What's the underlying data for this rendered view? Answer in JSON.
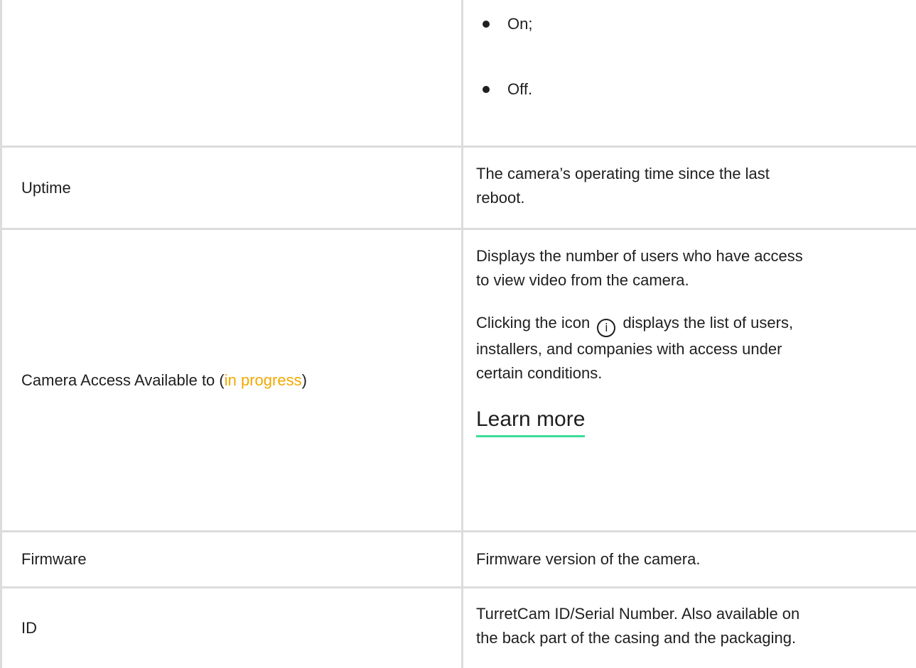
{
  "rows": [
    {
      "label": "",
      "bullets": [
        "On;",
        "Off."
      ]
    },
    {
      "label": "Uptime",
      "text_lines": [
        "The camera’s operating time since the last",
        "reboot."
      ]
    },
    {
      "label_main": "Camera Access Available to (",
      "label_link": "in progress",
      "label_end": ")",
      "para1_lines": [
        "Displays the number of users who have access",
        "to view video from the camera."
      ],
      "para2_before_icon": "Clicking the icon",
      "icon_glyph": "i",
      "para2_after_icon": "displays the list of users,",
      "para2_lines": [
        "installers, and companies with access under",
        "certain conditions."
      ],
      "link_label": "Learn more"
    },
    {
      "label": "Firmware",
      "text": "Firmware version of the camera."
    },
    {
      "label": "ID",
      "text_lines": [
        "TurretCam ID/Serial Number. Also available on",
        "the back part of the casing and the packaging."
      ]
    }
  ],
  "colors": {
    "accent": "#f2a900",
    "link_underline": "#3ddc97",
    "border": "#dcdcdc",
    "text": "#1f1f1f"
  },
  "icons": {
    "bullet": "dot-icon",
    "info": "info-circle-icon"
  }
}
